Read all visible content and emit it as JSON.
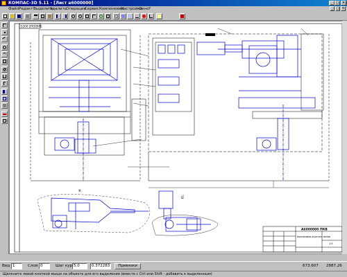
{
  "window": {
    "title": "КОМПАС-3D 5.11 - [Лист a6000000]",
    "controls": {
      "minimize": "_",
      "maximize": "□",
      "close": "×"
    }
  },
  "menu": [
    "Файл",
    "Редакт",
    "Выделить",
    "Удалить",
    "Операции",
    "Сервис",
    "Компоновка",
    "Настройка",
    "Окно",
    "?"
  ],
  "toolbar": {
    "icons": [
      "new-icon",
      "open-icon",
      "save-icon",
      "print-icon",
      "cut-icon",
      "copy-icon",
      "paste-icon",
      "undo-icon",
      "redo-icon",
      "zoom-in-icon",
      "zoom-out-icon",
      "zoom-window-icon",
      "pan-icon",
      "refresh-icon",
      "fit-icon",
      "grid-icon",
      "layers-icon",
      "properties-icon",
      "measure-icon",
      "snap-icon",
      "ortho-icon",
      "help-icon"
    ]
  },
  "left_tools": [
    "select-icon",
    "point-icon",
    "line-icon",
    "circle-icon",
    "arc-icon",
    "rectangle-icon",
    "hatch-icon",
    "dimension-icon",
    "text-icon",
    "edit-icon",
    "macro-icon",
    "insert-icon",
    "delete-icon",
    "move-icon"
  ],
  "drawing": {
    "top_left_label": "Б200 2ПО09РБ",
    "title_block_code": "А6000000 ПКВ",
    "title_block_name": "Компоновка агрегата линии"
  },
  "status": {
    "view_label": "Вид",
    "view_value": "1",
    "layer_label": "Слой",
    "layer_value": "0",
    "cursor_step_label": "Шаг курсора",
    "cursor_step_value": "5.0",
    "angle_value": "0.372283",
    "scale_button": "Привязки",
    "coord_x": "673.607",
    "coord_y": "2887.26"
  },
  "hint": "Щелкните левой кнопкой мыши на объекте для его выделения (вместе с Ctrl или Shift - добавить к выделенным)",
  "colors": {
    "accent": "#000080",
    "drawing": "#0000cc",
    "background": "#c0c0c0"
  }
}
